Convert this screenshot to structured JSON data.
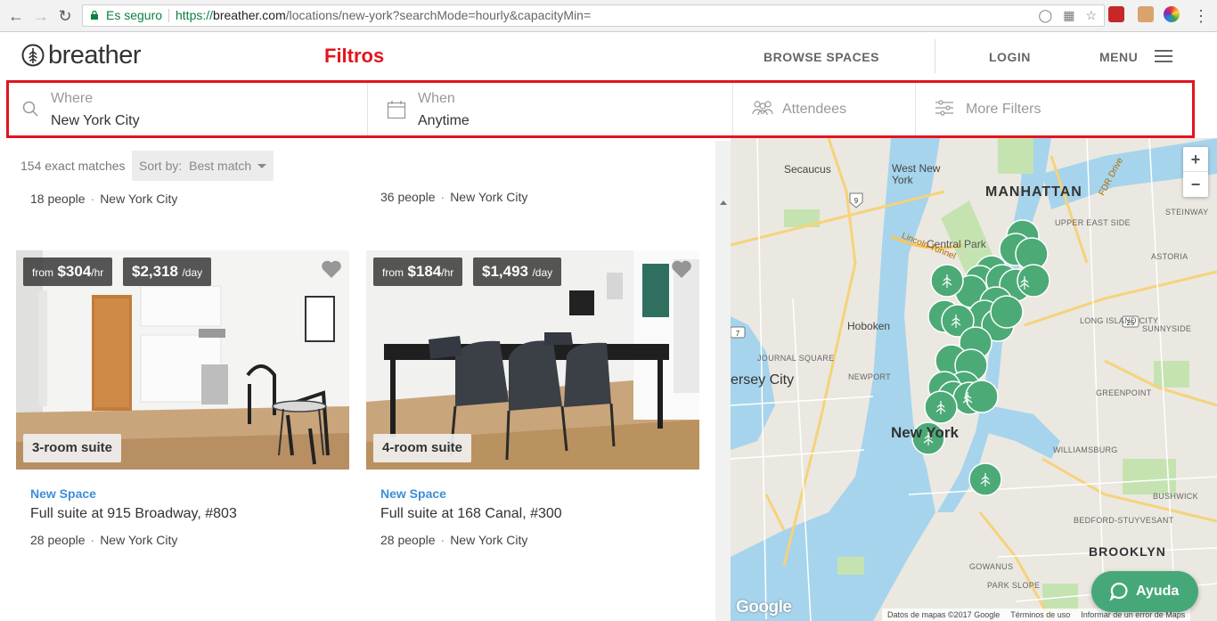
{
  "browser": {
    "secure_label": "Es seguro",
    "url_protocol": "https://",
    "url_host": "breather.com",
    "url_path": "/locations/new-york?searchMode=hourly&capacityMin="
  },
  "header": {
    "logo_text": "breather",
    "annotation": "Filtros",
    "browse_spaces": "BROWSE SPACES",
    "login": "LOGIN",
    "menu": "MENU"
  },
  "filters": {
    "where_label": "Where",
    "where_value": "New York City",
    "when_label": "When",
    "when_value": "Anytime",
    "attendees_label": "Attendees",
    "more_filters_label": "More Filters"
  },
  "results": {
    "count": "154 exact matches",
    "sort_label": "Sort by:",
    "sort_value": "Best match"
  },
  "partial_rows": [
    {
      "people": "18 people",
      "city": "New York City"
    },
    {
      "people": "36 people",
      "city": "New York City"
    }
  ],
  "listings": [
    {
      "hour_from": "from",
      "hour_price": "$304",
      "hour_unit": "/hr",
      "day_price": "$2,318",
      "day_unit": "/day",
      "suite": "3-room suite",
      "badge": "New Space",
      "title": "Full suite at 915 Broadway, #803",
      "people": "28 people",
      "city": "New York City"
    },
    {
      "hour_from": "from",
      "hour_price": "$184",
      "hour_unit": "/hr",
      "day_price": "$1,493",
      "day_unit": "/day",
      "suite": "4-room suite",
      "badge": "New Space",
      "title": "Full suite at 168 Canal, #300",
      "people": "28 people",
      "city": "New York City"
    }
  ],
  "map": {
    "zoom_in": "+",
    "zoom_out": "−",
    "labels": {
      "secaucus": "Secaucus",
      "west_new_york": "West New York",
      "manhattan": "MANHATTAN",
      "central_park": "Central Park",
      "hoboken": "Hoboken",
      "jersey_city": "ersey City",
      "new_york": "New York",
      "brooklyn": "BROOKLYN",
      "upper_east_side": "UPPER EAST SIDE",
      "astoria": "ASTORIA",
      "long_island_city": "LONG ISLAND CITY",
      "sunnyside": "SUNNYSIDE",
      "greenpoint": "GREENPOINT",
      "williamsburg": "WILLIAMSBURG",
      "bushwick": "BUSHWICK",
      "bed_stuy": "BEDFORD-STUYVESANT",
      "park_slope": "PARK SLOPE",
      "gowanus": "GOWANUS",
      "journal_square": "JOURNAL SQUARE",
      "newport": "NEWPORT",
      "steinway": "STEINWAY",
      "lincoln_tunnel": "Lincoln Tunnel",
      "fdr_drive": "FDR Drive"
    },
    "google": "Google",
    "footer_data": "Datos de mapas ©2017 Google",
    "footer_terms": "Términos de uso",
    "footer_report": "Informar de un error de Maps",
    "help_label": "Ayuda"
  }
}
